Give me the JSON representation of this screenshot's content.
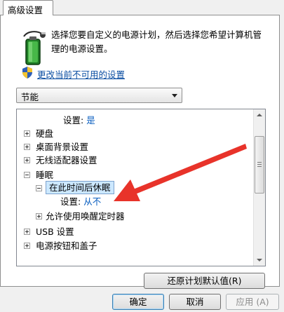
{
  "window": {
    "tab_label": "高级设置"
  },
  "header": {
    "description": "选择您要自定义的电源计划，然后选择您希望计算机管理的电源设置。",
    "icon": "power-plan-icon"
  },
  "change_link": {
    "label": "更改当前不可用的设置",
    "icon": "uac-shield-icon"
  },
  "plan_select": {
    "value": "节能"
  },
  "tree": {
    "setting_prefix": "设置:",
    "rows": {
      "top_setting_value": "是",
      "hard_disk": "硬盘",
      "desktop_background": "桌面背景设置",
      "wireless": "无线适配器设置",
      "sleep": "睡眠",
      "sleep_after": "在此时间后休眠",
      "sleep_after_value": "从不",
      "wake_timers": "允许使用唤醒定时器",
      "usb": "USB 设置",
      "power_buttons": "电源按钮和盖子"
    }
  },
  "buttons": {
    "restore": "还原计划默认值(R)",
    "ok": "确定",
    "cancel": "取消",
    "apply": "应用 (A)"
  },
  "colors": {
    "link": "#0b4ea2",
    "value": "#0b5fc0",
    "arrow": "#e8332a",
    "selection": "#cce8ff"
  }
}
